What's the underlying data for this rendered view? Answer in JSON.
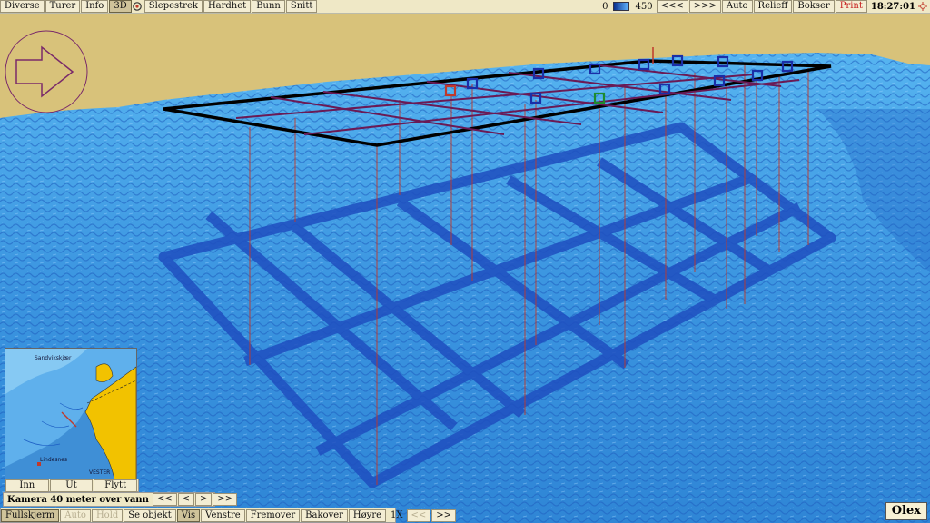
{
  "colors": {
    "sky": "#d8c27a",
    "sea_light": "#3aa0e8",
    "sea_dark": "#1d5fc4",
    "grid_line": "#000000",
    "marker": "#1a2fa8"
  },
  "toolbar": {
    "items": [
      "Diverse",
      "Turer",
      "Info",
      "3D",
      "Slepestrek",
      "Hardhet",
      "Bunn",
      "Snitt"
    ],
    "depth_min": "0",
    "depth_max": "450",
    "nav_back": "<<<",
    "nav_forward": ">>>",
    "right_items": [
      "Auto",
      "Relieff",
      "Bokser"
    ],
    "print": "Print",
    "time": "18:27:01"
  },
  "minimap": {
    "buttons": [
      "Inn",
      "Ut",
      "Flytt"
    ],
    "labels": [
      "Sandvikskjær",
      "Lindesnes",
      "VESTER"
    ]
  },
  "camera": {
    "caption": "Kamera 40 meter over vann",
    "buttons": [
      "<<",
      "<",
      ">",
      ">>"
    ]
  },
  "bottombar": {
    "items": [
      "Fullskjerm",
      "Auto",
      "Hold",
      "Se objekt",
      "Vis",
      "Venstre",
      "Fremover",
      "Bakover",
      "Høyre"
    ],
    "zoom": "1X",
    "zoom_back": "<<",
    "zoom_forward": ">>"
  },
  "brand": "Olex"
}
